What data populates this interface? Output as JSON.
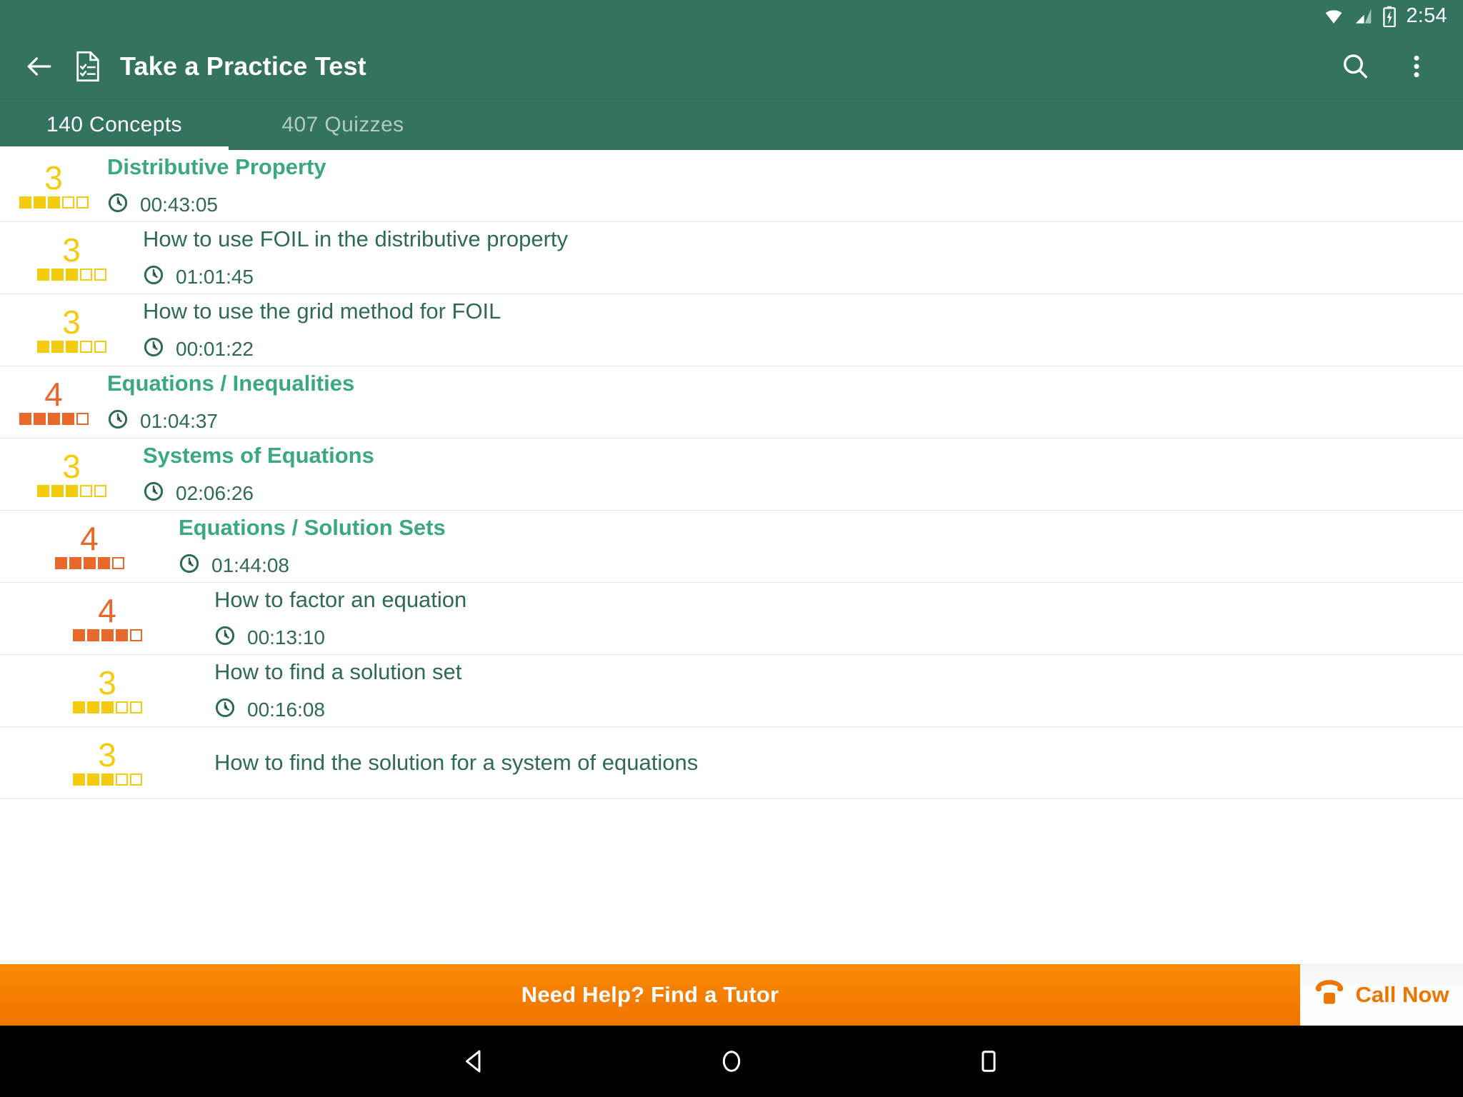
{
  "statusbar": {
    "time": "2:54",
    "wifi_icon": "wifi-icon",
    "signal_icon": "cellular-signal-icon",
    "battery_icon": "battery-charging-icon"
  },
  "appbar": {
    "back_icon": "arrow-left-icon",
    "doc_icon": "practice-test-document-icon",
    "title": "Take a Practice Test",
    "search_icon": "search-icon",
    "overflow_icon": "more-vertical-icon"
  },
  "tabs": [
    {
      "label": "140 Concepts",
      "active": true
    },
    {
      "label": "407 Quizzes",
      "active": false
    }
  ],
  "colors": {
    "primary": "#337360",
    "accent_green": "#3aa97e",
    "text_green": "#2f6a56",
    "rating_yellow": "#f5cb0f",
    "rating_orange": "#e8682c",
    "banner_orange": "#f57c00"
  },
  "list": {
    "clock_icon": "clock-icon",
    "rows": [
      {
        "rating": 3,
        "rating_color": "yellow",
        "title": "Distributive Property",
        "kind": "concept",
        "indent": 0,
        "time": "00:43:05"
      },
      {
        "rating": 3,
        "rating_color": "yellow",
        "title": "How to use FOIL in the distributive property",
        "kind": "sub",
        "indent": 1,
        "time": "01:01:45"
      },
      {
        "rating": 3,
        "rating_color": "yellow",
        "title": "How to use the grid method for FOIL",
        "kind": "sub",
        "indent": 1,
        "time": "00:01:22"
      },
      {
        "rating": 4,
        "rating_color": "orange",
        "title": "Equations / Inequalities",
        "kind": "concept",
        "indent": 0,
        "time": "01:04:37"
      },
      {
        "rating": 3,
        "rating_color": "yellow",
        "title": "Systems of Equations",
        "kind": "concept",
        "indent": 1,
        "time": "02:06:26"
      },
      {
        "rating": 4,
        "rating_color": "orange",
        "title": "Equations / Solution Sets",
        "kind": "concept",
        "indent": 2,
        "time": "01:44:08"
      },
      {
        "rating": 4,
        "rating_color": "orange",
        "title": "How to factor an equation",
        "kind": "sub",
        "indent": 3,
        "time": "00:13:10"
      },
      {
        "rating": 3,
        "rating_color": "yellow",
        "title": "How to find a solution set",
        "kind": "sub",
        "indent": 3,
        "time": "00:16:08"
      },
      {
        "rating": 3,
        "rating_color": "yellow",
        "title": "How to find the solution for a system of equations",
        "kind": "sub",
        "indent": 3,
        "time": ""
      }
    ]
  },
  "tutor_banner": {
    "message": "Need Help? Find a Tutor",
    "call_label": "Call Now",
    "phone_icon": "phone-icon"
  },
  "navbar": {
    "back_icon": "nav-back-triangle-icon",
    "home_icon": "nav-home-circle-icon",
    "recents_icon": "nav-recents-square-icon"
  }
}
